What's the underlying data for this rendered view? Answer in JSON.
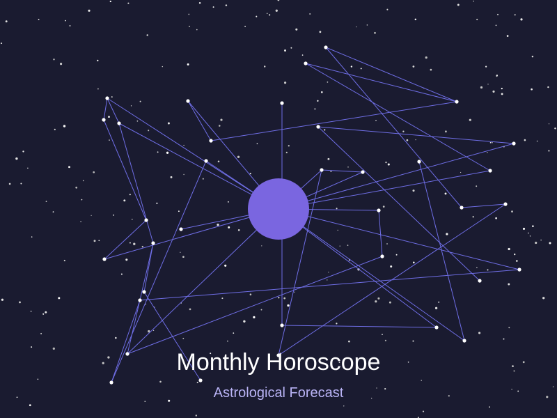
{
  "header": {
    "title": "Monthly Horoscope",
    "subtitle": "Astrological Forecast"
  },
  "colors": {
    "background": "#1a1b30",
    "sun": "#7a66e0",
    "constellation_line": "#6f6ee6",
    "star": "#ffffff",
    "subtitle": "#b9b3f5"
  },
  "icons": {
    "center": "sun-icon",
    "stars": "star-icon"
  }
}
